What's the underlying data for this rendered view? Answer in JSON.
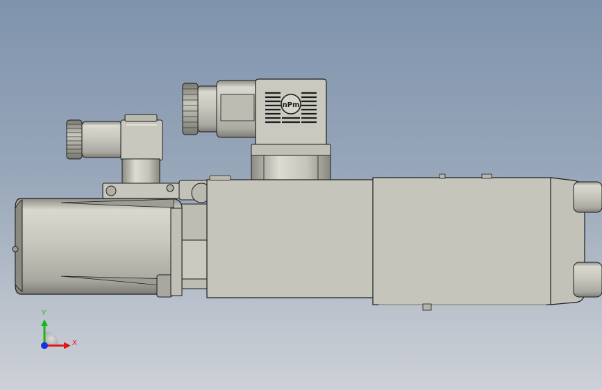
{
  "viewport": {
    "background_top": "#7f93ad",
    "background_bottom": "#cdd1d7"
  },
  "model": {
    "logo_text": "nPm",
    "body_color": "#c5c5bb",
    "edge_color": "#1c1c1c",
    "shade_color": "#9a9a92"
  },
  "triad": {
    "x_label": "X",
    "y_label": "Y",
    "x_color": "#e01818",
    "y_color": "#18b818",
    "z_color": "#1830e0"
  }
}
